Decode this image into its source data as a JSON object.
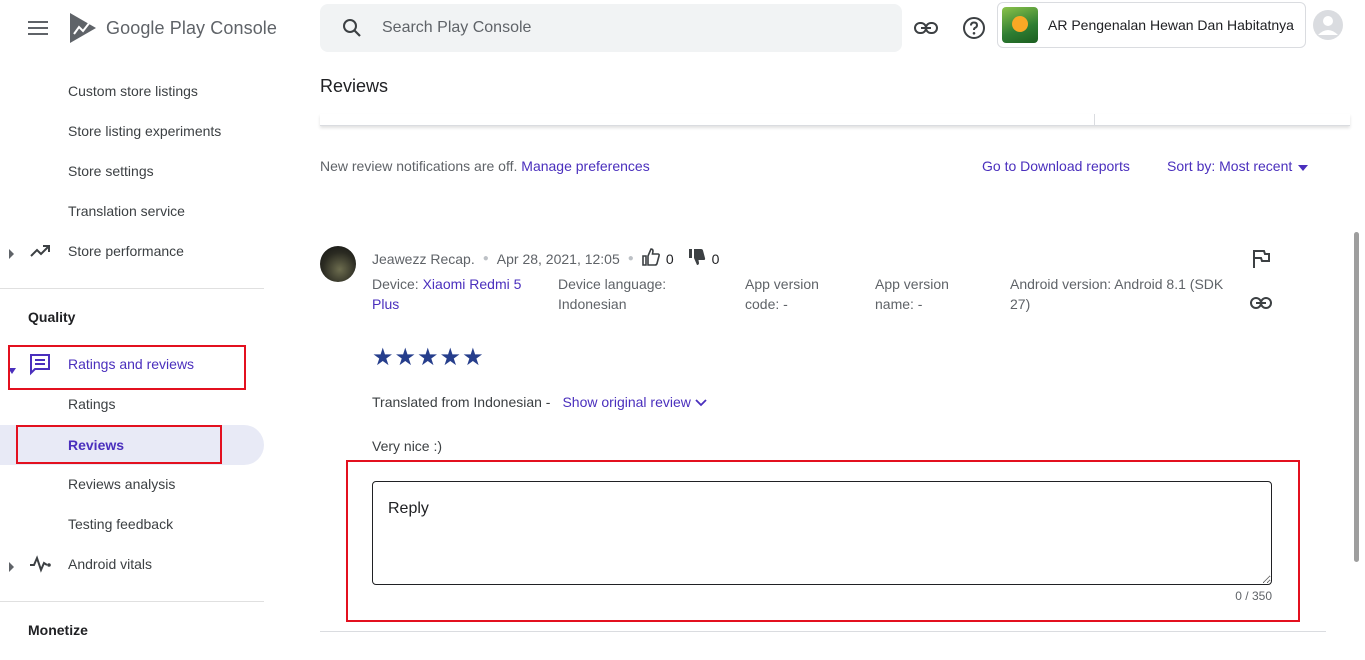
{
  "header": {
    "logo_word1": "Google Play",
    "logo_word2": "Console",
    "search_placeholder": "Search Play Console",
    "app_name": "AR Pengenalan Hewan Dan Habitatnya"
  },
  "sidebar": {
    "items_top": [
      {
        "label": "Custom store listings"
      },
      {
        "label": "Store listing experiments"
      },
      {
        "label": "Store settings"
      },
      {
        "label": "Translation service"
      },
      {
        "label": "Store performance"
      }
    ],
    "section_quality": "Quality",
    "ratings_reviews": "Ratings and reviews",
    "sub_items": [
      {
        "label": "Ratings"
      },
      {
        "label": "Reviews"
      },
      {
        "label": "Reviews analysis"
      },
      {
        "label": "Testing feedback"
      }
    ],
    "android_vitals": "Android vitals",
    "section_monetize": "Monetize"
  },
  "main": {
    "title": "Reviews",
    "notice_text": "New review notifications are off.",
    "manage_link": "Manage preferences",
    "download_link": "Go to Download reports",
    "sort_label": "Sort by: Most recent"
  },
  "review": {
    "author": "Jeawezz Recap.",
    "date": "Apr 28, 2021, 12:05",
    "thumbs_up": "0",
    "thumbs_down": "0",
    "device_label": "Device:",
    "device_value_line1": "Xiaomi Redmi 5",
    "device_value_line2": "Plus",
    "device_lang_line1": "Device language:",
    "device_lang_line2": "Indonesian",
    "app_code_line1": "App version",
    "app_code_line2": "code: -",
    "app_name_line1": "App version",
    "app_name_line2": "name: -",
    "android_line1": "Android version: Android 8.1 (SDK",
    "android_line2": "27)",
    "rating": 5,
    "translated_text": "Translated from Indonesian -",
    "show_original": "Show original review",
    "text": "Very nice :)",
    "reply_placeholder": "Reply",
    "reply_counter": "0 / 350"
  },
  "colors": {
    "accent": "#4a2fbd",
    "star": "#263e8c",
    "highlight_box": "#e3101f"
  }
}
